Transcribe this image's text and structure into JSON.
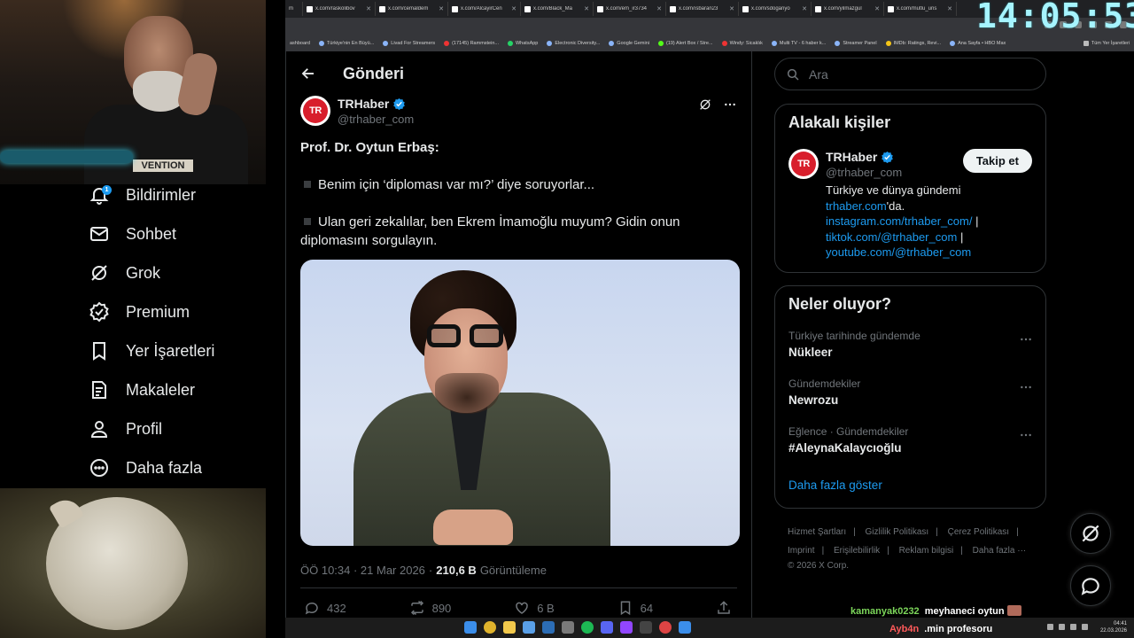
{
  "browser": {
    "tabs": [
      "x.com/raskolibov",
      "x.com/cemaldem",
      "x.com/AlcayirCen",
      "x.com/Black_Ma",
      "x.com/em_ir3734",
      "x.com/ısbaran23",
      "x.com/sdoganyo",
      "x.com/yilmazgul",
      "x.com/mutlu_uns"
    ],
    "bookmarks": [
      "ashboard",
      "Türkiye'nin En Büyü...",
      "Livad For Streamers",
      "(17145) Rammstein...",
      "WhatsApp",
      "Electronic Diversity...",
      "Google Gemini",
      "(19) Alert Box / Stre...",
      "Windy: Sicaklık",
      "Multi TV - 6 haber k...",
      "Streamer Panel",
      "IMDb: Ratings, Revi...",
      "Ana Sayfa • HBO Max",
      "Tüm Yer İşaretleri"
    ]
  },
  "overlay": {
    "clock": "14:05:53",
    "cam_shirt_text": "VENTION",
    "chat": [
      {
        "user": "kamanyak0232",
        "message": "meyhaneci oytun"
      },
      {
        "user": "Ayb4n",
        "message": ".min profesoru"
      }
    ]
  },
  "nav": {
    "notif_count": "1",
    "items": [
      {
        "label": "Bildirimler",
        "icon": "bell-icon"
      },
      {
        "label": "Sohbet",
        "icon": "mail-icon"
      },
      {
        "label": "Grok",
        "icon": "grok-icon"
      },
      {
        "label": "Premium",
        "icon": "verified-icon"
      },
      {
        "label": "Yer İşaretleri",
        "icon": "bookmark-icon"
      },
      {
        "label": "Makaleler",
        "icon": "article-icon"
      },
      {
        "label": "Profil",
        "icon": "person-icon"
      },
      {
        "label": "Daha fazla",
        "icon": "more-circle-icon"
      }
    ]
  },
  "header": {
    "title": "Gönderi"
  },
  "post": {
    "author_name": "TRHaber",
    "author_handle": "@trhaber_com",
    "avatar_text": "TR",
    "line1": "Prof. Dr. Oytun Erbaş:",
    "line2": "Benim için ‘diploması var mı?’ diye soruyorlar...",
    "line3": "Ulan geri zekalılar, ben Ekrem İmamoğlu muyum? Gidin onun diplomasını sorgulayın.",
    "time": "ÖÖ 10:34 · 21 Mar 2026",
    "sep": "·",
    "views_count": "210,6 B",
    "views_label": "Görüntüleme",
    "replies": "432",
    "reposts": "890",
    "likes": "6 B",
    "bookmarks": "64"
  },
  "search": {
    "placeholder": "Ara"
  },
  "related": {
    "title": "Alakalı kişiler",
    "name": "TRHaber",
    "handle": "@trhaber_com",
    "follow_label": "Takip et",
    "bio_text": "Türkiye ve dünya gündemi",
    "bio_link1": "trhaber.com",
    "bio_link1_suffix": "'da.",
    "bio_link2": "instagram.com/trhaber_com/",
    "bio_link3": "tiktok.com/@trhaber_com",
    "bio_link4": "youtube.com/@trhaber_com",
    "pipe": "|"
  },
  "trends": {
    "title": "Neler oluyor?",
    "items": [
      {
        "context": "Türkiye tarihinde gündemde",
        "name": "Nükleer"
      },
      {
        "context": "Gündemdekiler",
        "name": "Newrozu"
      },
      {
        "context": "Eğlence · Gündemdekiler",
        "name": "#AleynaKalaycıoğlu"
      }
    ],
    "show_more": "Daha fazla göster"
  },
  "footer": {
    "links": [
      "Hizmet Şartları",
      "Gizlilik Politikası",
      "Çerez Politikası",
      "Erişilebilirlik",
      "Reklam bilgisi",
      "Daha fazla ···"
    ],
    "imprint": "Imprint",
    "copyright": "© 2026 X Corp."
  },
  "taskbar": {
    "time": "04:41",
    "date": "22.03.2026"
  }
}
